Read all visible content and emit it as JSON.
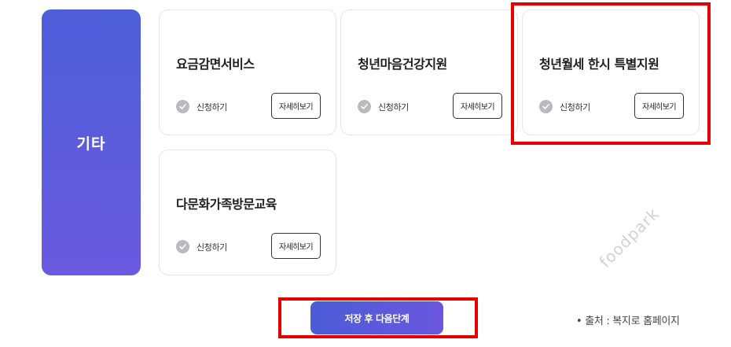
{
  "category": {
    "label": "기타"
  },
  "cards": [
    {
      "title": "요금감면서비스",
      "apply_label": "신청하기",
      "detail_label": "자세히보기"
    },
    {
      "title": "청년마음건강지원",
      "apply_label": "신청하기",
      "detail_label": "자세히보기"
    },
    {
      "title": "청년월세 한시 특별지원",
      "apply_label": "신청하기",
      "detail_label": "자세히보기",
      "highlighted": true
    },
    {
      "title": "다문화가족방문교육",
      "apply_label": "신청하기",
      "detail_label": "자세히보기"
    }
  ],
  "footer": {
    "next_button_label": "저장 후 다음단계",
    "source_text": "•  출처 : 복지로  홈페이지"
  },
  "watermark": "foodpark",
  "colors": {
    "accent": "#5a5adc",
    "highlight": "#e60000",
    "check_gray": "#b9b9be"
  },
  "icons": {
    "apply": "check-circle-icon"
  }
}
